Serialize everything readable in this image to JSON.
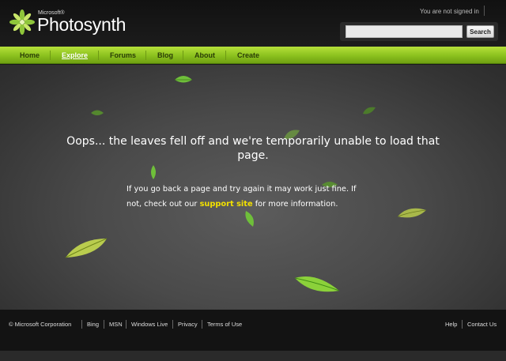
{
  "header": {
    "logo_small": "Microsoft®",
    "logo_text": "Photosynth",
    "signed_status": "You are not signed in",
    "search_placeholder": "",
    "search_button": "Search"
  },
  "nav": {
    "items": [
      {
        "label": "Home"
      },
      {
        "label": "Explore"
      },
      {
        "label": "Forums"
      },
      {
        "label": "Blog"
      },
      {
        "label": "About"
      },
      {
        "label": "Create"
      }
    ]
  },
  "main": {
    "headline": "Oops... the leaves fell off and we're temporarily unable to load that page.",
    "body_before": "If you go back a page and try again it may work just fine. If not, check out our ",
    "support_link": "support site",
    "body_after": " for more information."
  },
  "footer": {
    "left_links": [
      {
        "label": "© Microsoft Corporation"
      },
      {
        "label": "Bing"
      },
      {
        "label": "MSN"
      },
      {
        "label": "Windows Live"
      },
      {
        "label": "Privacy"
      },
      {
        "label": "Terms of Use"
      }
    ],
    "right_links": [
      {
        "label": "Help"
      },
      {
        "label": "Contact Us"
      }
    ]
  },
  "colors": {
    "nav_green": "#8bc11e",
    "link_yellow": "#f2e000",
    "leaf_green": "#5fae2a"
  }
}
